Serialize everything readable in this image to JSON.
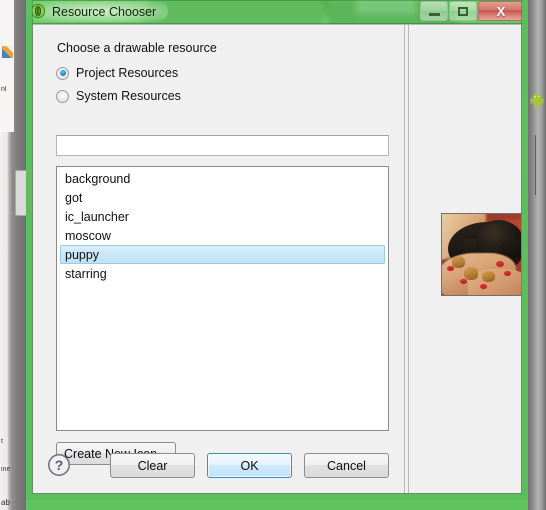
{
  "window": {
    "title": "Resource Chooser",
    "icon": "resource-chooser-icon",
    "controls": {
      "minimize_label": "–",
      "maximize_label": "□",
      "close_label": "X"
    }
  },
  "dialog": {
    "prompt": "Choose a drawable resource",
    "radios": [
      {
        "label": "Project Resources",
        "selected": true
      },
      {
        "label": "System Resources",
        "selected": false
      }
    ],
    "filter": {
      "value": "",
      "placeholder": ""
    },
    "list": {
      "items": [
        {
          "label": "background",
          "selected": false
        },
        {
          "label": "got",
          "selected": false
        },
        {
          "label": "ic_launcher",
          "selected": false
        },
        {
          "label": "moscow",
          "selected": false
        },
        {
          "label": "puppy",
          "selected": true
        },
        {
          "label": "starring",
          "selected": false
        }
      ]
    },
    "create_new_icon_label": "Create New Icon...",
    "buttons": {
      "help_icon": "help-question-icon",
      "clear_label": "Clear",
      "ok_label": "OK",
      "cancel_label": "Cancel"
    },
    "preview": {
      "image_alt": "puppy",
      "image_description": "Photograph of a black and tan puppy resting in a pair of hands with red nail polish against a warm red-orange background"
    }
  },
  "background": {
    "desktop_icon": "android-robot-icon",
    "ide_fragment_text": "ab"
  },
  "colors": {
    "frame_green": "#5cbe58",
    "titlebar_green": "#6cc868",
    "dialog_face": "#f0f0f0",
    "selection_blue": "#cce8f8",
    "selection_border": "#9cc8e0",
    "ok_focus_border": "#3c8dbc",
    "close_red": "#c7564b",
    "list_background": "#ffffff",
    "text": "#101010"
  }
}
